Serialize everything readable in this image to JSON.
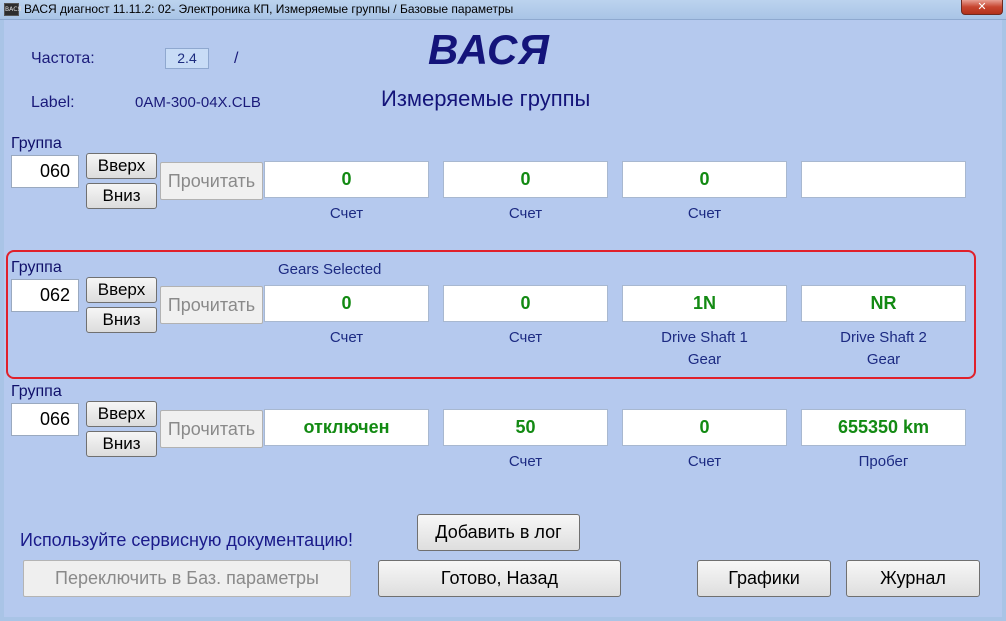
{
  "window": {
    "icon_text": "ВАСЯ",
    "title": "ВАСЯ диагност 11.11.2: 02- Электроника КП,  Измеряемые группы / Базовые параметры",
    "close_glyph": "✕"
  },
  "header": {
    "freq_label": "Частота:",
    "freq_value": "2.4",
    "freq_sep": "/",
    "label_label": "Label:",
    "label_value": "0AM-300-04X.CLB",
    "brand": "ВАСЯ",
    "subtitle": "Измеряемые группы"
  },
  "groups": [
    {
      "group_label": "Группа",
      "group_number": "060",
      "up_label": "Вверх",
      "down_label": "Вниз",
      "read_label": "Прочитать",
      "caption": "",
      "fields": [
        {
          "value": "0",
          "label1": "Счет",
          "label2": ""
        },
        {
          "value": "0",
          "label1": "Счет",
          "label2": ""
        },
        {
          "value": "0",
          "label1": "Счет",
          "label2": ""
        },
        {
          "value": "",
          "label1": "",
          "label2": ""
        }
      ]
    },
    {
      "group_label": "Группа",
      "group_number": "062",
      "up_label": "Вверх",
      "down_label": "Вниз",
      "read_label": "Прочитать",
      "caption": "Gears Selected",
      "fields": [
        {
          "value": "0",
          "label1": "Счет",
          "label2": ""
        },
        {
          "value": "0",
          "label1": "Счет",
          "label2": ""
        },
        {
          "value": "1N",
          "label1": "Drive Shaft 1",
          "label2": "Gear"
        },
        {
          "value": "NR",
          "label1": "Drive Shaft 2",
          "label2": "Gear"
        }
      ]
    },
    {
      "group_label": "Группа",
      "group_number": "066",
      "up_label": "Вверх",
      "down_label": "Вниз",
      "read_label": "Прочитать",
      "caption": "",
      "fields": [
        {
          "value": "отключен",
          "label1": "",
          "label2": ""
        },
        {
          "value": "50",
          "label1": "Счет",
          "label2": ""
        },
        {
          "value": "0",
          "label1": "Счет",
          "label2": ""
        },
        {
          "value": "655350 km",
          "label1": "Пробег",
          "label2": ""
        }
      ]
    }
  ],
  "footer": {
    "hint": "Используйте сервисную документацию!",
    "add_log": "Добавить в лог",
    "switch_basic": "Переключить в Баз. параметры",
    "done_back": "Готово, Назад",
    "graphs": "Графики",
    "journal": "Журнал"
  },
  "colors": {
    "background": "#b5c9ee",
    "value_text": "#138a13",
    "highlight_border": "#e0202a",
    "label_text": "#1a1a7a"
  }
}
